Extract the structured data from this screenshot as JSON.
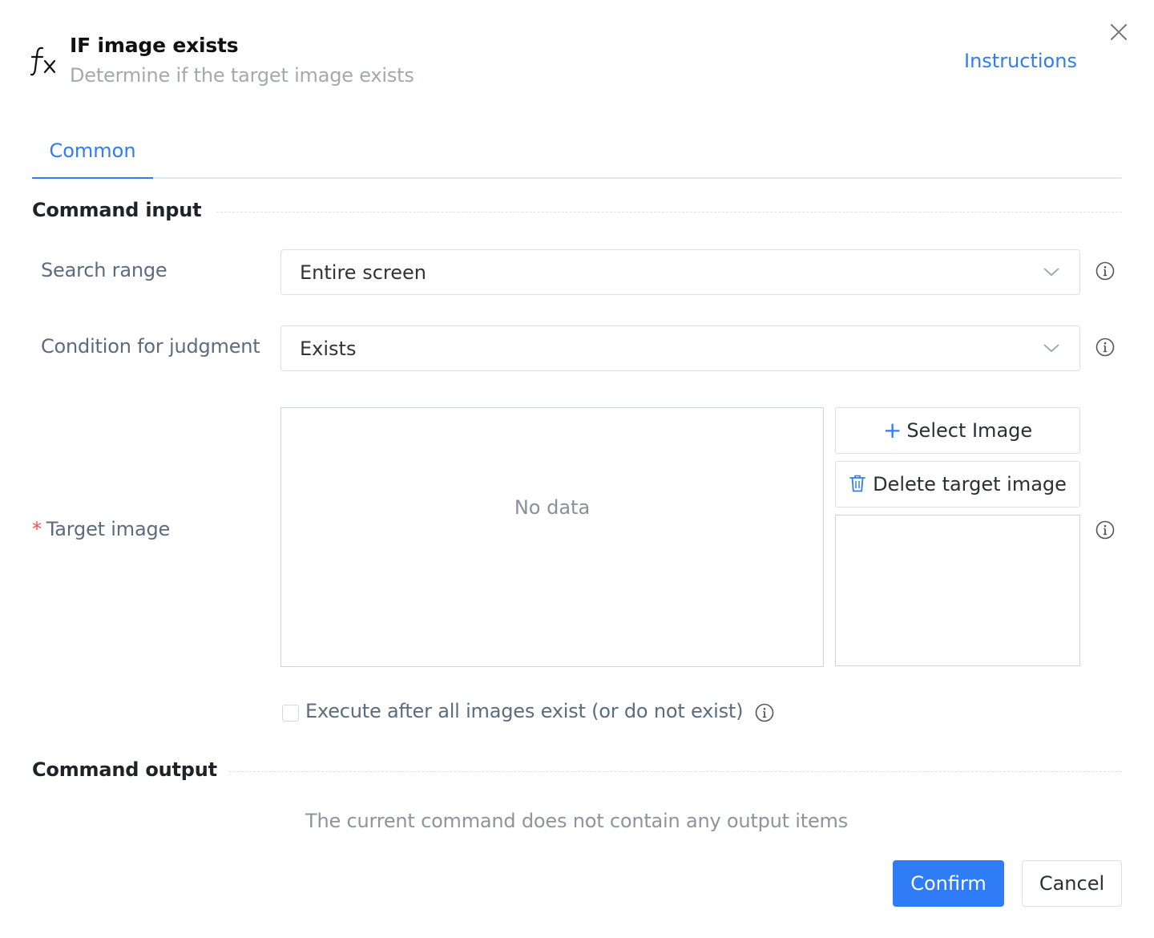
{
  "header": {
    "title": "IF image exists",
    "subtitle": "Determine if the target image exists",
    "instructions_link": "Instructions",
    "icon": "fx-icon"
  },
  "tabs": [
    {
      "label": "Common",
      "active": true
    }
  ],
  "command_input": {
    "section_title": "Command input",
    "search_range": {
      "label": "Search range",
      "value": "Entire screen"
    },
    "condition": {
      "label": "Condition for judgment",
      "value": "Exists"
    },
    "target_image": {
      "required_mark": "*",
      "label": "Target image",
      "empty_text": "No data",
      "select_button": "Select Image",
      "delete_button": "Delete target image"
    },
    "execute_all": {
      "label": "Execute after all images exist (or do not exist)",
      "checked": false
    }
  },
  "command_output": {
    "section_title": "Command output",
    "empty_text": "The current command does not contain any output items"
  },
  "footer": {
    "confirm": "Confirm",
    "cancel": "Cancel"
  },
  "colors": {
    "accent": "#2f7cf6",
    "required": "#f05050"
  }
}
